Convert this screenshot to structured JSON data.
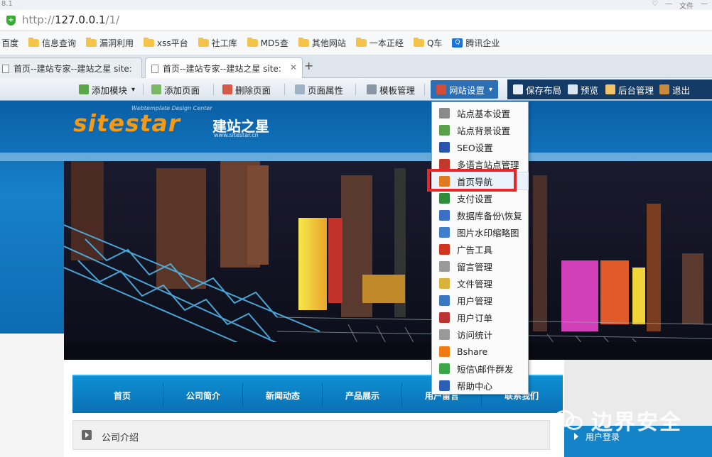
{
  "browser": {
    "version_text": "8.1",
    "window_controls": [
      "♡",
      "—",
      "文件",
      "—"
    ],
    "url_prefix": "http://",
    "url_host": "127.0.0.1",
    "url_path": "/1/",
    "bookmarks": [
      {
        "label": "百度",
        "icon": "none"
      },
      {
        "label": "信息查询",
        "icon": "folder-icon"
      },
      {
        "label": "漏洞利用",
        "icon": "folder-icon"
      },
      {
        "label": "xss平台",
        "icon": "folder-icon"
      },
      {
        "label": "社工库",
        "icon": "folder-icon"
      },
      {
        "label": "MD5查",
        "icon": "folder-icon"
      },
      {
        "label": "其他网站",
        "icon": "folder-icon"
      },
      {
        "label": "一本正经",
        "icon": "folder-icon"
      },
      {
        "label": "Q车",
        "icon": "folder-icon"
      },
      {
        "label": "腾讯企业",
        "icon": "qq-icon"
      }
    ],
    "tabs": [
      {
        "title": "首页--建站专家--建站之星 site:"
      },
      {
        "title": "首页--建站专家--建站之星 site:"
      }
    ],
    "new_tab": "+",
    "close": "✕"
  },
  "toolbar": {
    "add_module": "添加模块",
    "add_page": "添加页面",
    "delete_page": "删除页面",
    "page_props": "页面属性",
    "template_manage": "模板管理",
    "site_settings": "网站设置",
    "save_layout": "保存布局",
    "preview": "预览",
    "admin": "后台管理",
    "logout": "退出",
    "caret": "▾"
  },
  "site": {
    "logo_main": "sitestar",
    "logo_cn": "建站之星",
    "logo_tagline": "Webtemplate Design Center",
    "logo_url": "www.sitestar.cn",
    "nav": [
      "首页",
      "公司简介",
      "新闻动态",
      "产品展示",
      "用户留言",
      "联系我们"
    ],
    "company_intro": "公司介绍",
    "user_login": "用户登录"
  },
  "dropdown": {
    "items": [
      {
        "label": "站点基本设置",
        "icon": "gear-icon",
        "color": "#8a8a8a"
      },
      {
        "label": "站点背景设置",
        "icon": "background-icon",
        "color": "#5aa04a"
      },
      {
        "label": "SEO设置",
        "icon": "seo-icon",
        "color": "#2a55a8"
      },
      {
        "label": "多语言站点管理",
        "icon": "language-icon",
        "color": "#c0392b"
      },
      {
        "label": "首页导航",
        "icon": "home-icon",
        "color": "#e07a1f"
      },
      {
        "label": "支付设置",
        "icon": "payment-icon",
        "color": "#2f8c3d"
      },
      {
        "label": "数据库备份\\恢复",
        "icon": "database-icon",
        "color": "#3b6fc4"
      },
      {
        "label": "图片水印缩略图",
        "icon": "image-icon",
        "color": "#3f7ec9"
      },
      {
        "label": "广告工具",
        "icon": "ad-icon",
        "color": "#d0341f"
      },
      {
        "label": "留言管理",
        "icon": "message-icon",
        "color": "#9a9a9a"
      },
      {
        "label": "文件管理",
        "icon": "file-icon",
        "color": "#d8b23a"
      },
      {
        "label": "用户管理",
        "icon": "users-icon",
        "color": "#3a78c0"
      },
      {
        "label": "用户订单",
        "icon": "order-icon",
        "color": "#b33"
      },
      {
        "label": "访问统计",
        "icon": "stats-icon",
        "color": "#999"
      },
      {
        "label": "Bshare",
        "icon": "bshare-icon",
        "color": "#f07b12"
      },
      {
        "label": "短信\\邮件群发",
        "icon": "sms-icon",
        "color": "#3aa648"
      },
      {
        "label": "帮助中心",
        "icon": "help-icon",
        "color": "#2a5fb5"
      }
    ],
    "highlighted_index": 4,
    "highlight_color": "#e8272a"
  },
  "watermark": {
    "text": "边界安全"
  }
}
